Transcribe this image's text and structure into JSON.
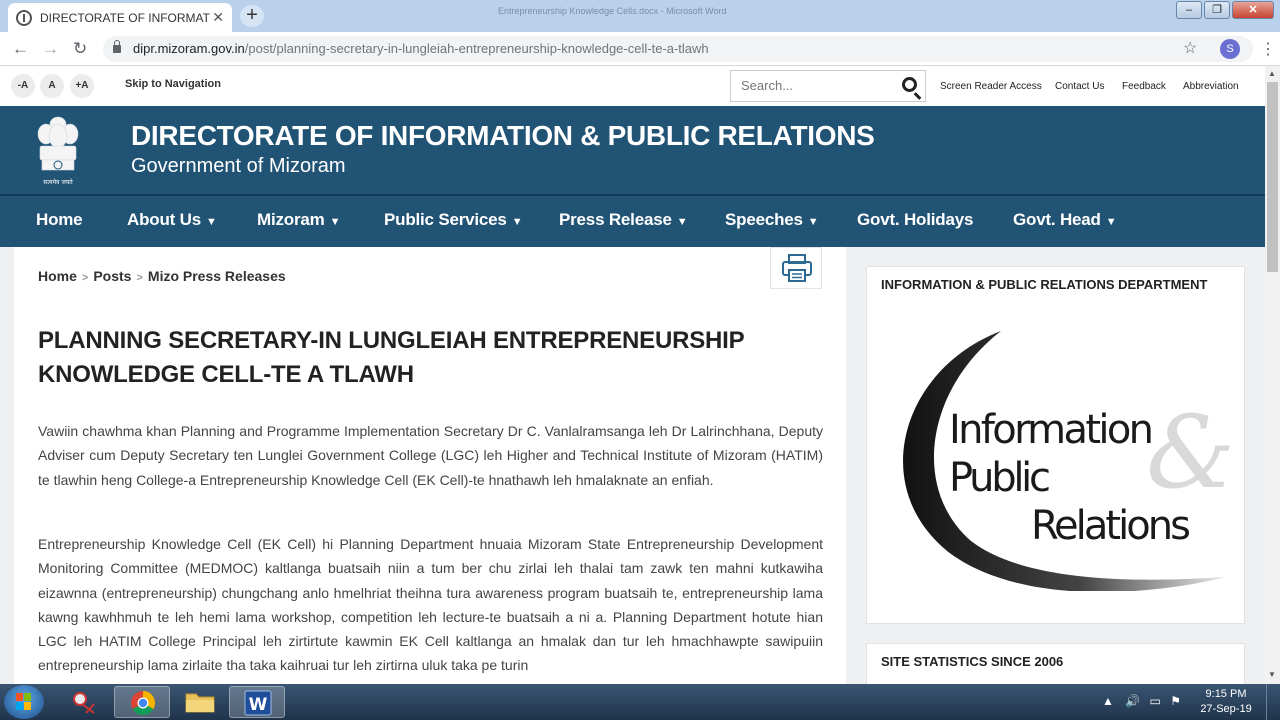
{
  "browser": {
    "tab_title": "DIRECTORATE OF INFORMATION",
    "window_title": "Entrepreneurship Knowledge Cells.docx - Microsoft Word",
    "url_host": "dipr.mizoram.gov.in",
    "url_path": "/post/planning-secretary-in-lungleiah-entrepreneurship-knowledge-cell-te-a-tlawh",
    "profile_initial": "S"
  },
  "util": {
    "font_small": "-A",
    "font_normal": "A",
    "font_large": "+A",
    "skip": "Skip to Navigation",
    "search_placeholder": "Search...",
    "links": [
      "Screen Reader Access",
      "Contact Us",
      "Feedback",
      "Abbreviation"
    ]
  },
  "header": {
    "title": "DIRECTORATE OF INFORMATION & PUBLIC RELATIONS",
    "subtitle": "Government of Mizoram",
    "emblem_caption": "सत्यमेव जयते"
  },
  "nav": [
    "Home",
    "About Us",
    "Mizoram",
    "Public Services",
    "Press Release",
    "Speeches",
    "Govt. Holidays",
    "Govt. Head"
  ],
  "breadcrumb": [
    "Home",
    "Posts",
    "Mizo Press Releases"
  ],
  "article": {
    "title": "PLANNING SECRETARY-IN LUNGLEIAH ENTREPRENEURSHIP KNOWLEDGE CELL-TE A TLAWH",
    "para1": "Vawiin chawhma khan Planning and Programme Implementation Secretary Dr C. Vanlalramsanga leh Dr Lalrinchhana, Deputy Adviser cum Deputy Secretary ten Lunglei Government College (LGC) leh  Higher and Technical Institute of Mizoram (HATIM) te tlawhin heng College-a Entrepreneurship Knowledge Cell (EK Cell)-te hnathawh leh hmalaknate an enfiah.",
    "para2": "Entrepreneurship Knowledge Cell (EK Cell) hi Planning Department hnuaia Mizoram State Entrepreneurship Development Monitoring Committee (MEDMOC) kaltlanga buatsaih niin a tum ber chu zirlai leh thalai tam zawk ten mahni kutkawiha eizawnna (entrepreneurship) chungchang anlo hmelhriat theihna tura awareness program buatsaih te, entrepreneurship lama kawng kawhhmuh te leh hemi lama workshop, competition leh lecture-te buatsaih a ni a. Planning Department hotute hian LGC leh HATIM College Principal leh zirtirtute kawmin EK Cell kaltlanga an hmalak dan tur leh hmachhawpte sawipuiin entrepreneurship lama zirlaite tha taka kaihruai tur leh zirtirna uluk taka pe turin"
  },
  "sidebar": {
    "dept_heading": "INFORMATION & PUBLIC RELATIONS DEPARTMENT",
    "logo_line1": "Information",
    "logo_line2": "Public",
    "logo_line3": "Relations",
    "logo_amp": "&",
    "stats_heading": "SITE STATISTICS SINCE 2006"
  },
  "taskbar": {
    "time": "9:15 PM",
    "date": "27-Sep-19"
  }
}
